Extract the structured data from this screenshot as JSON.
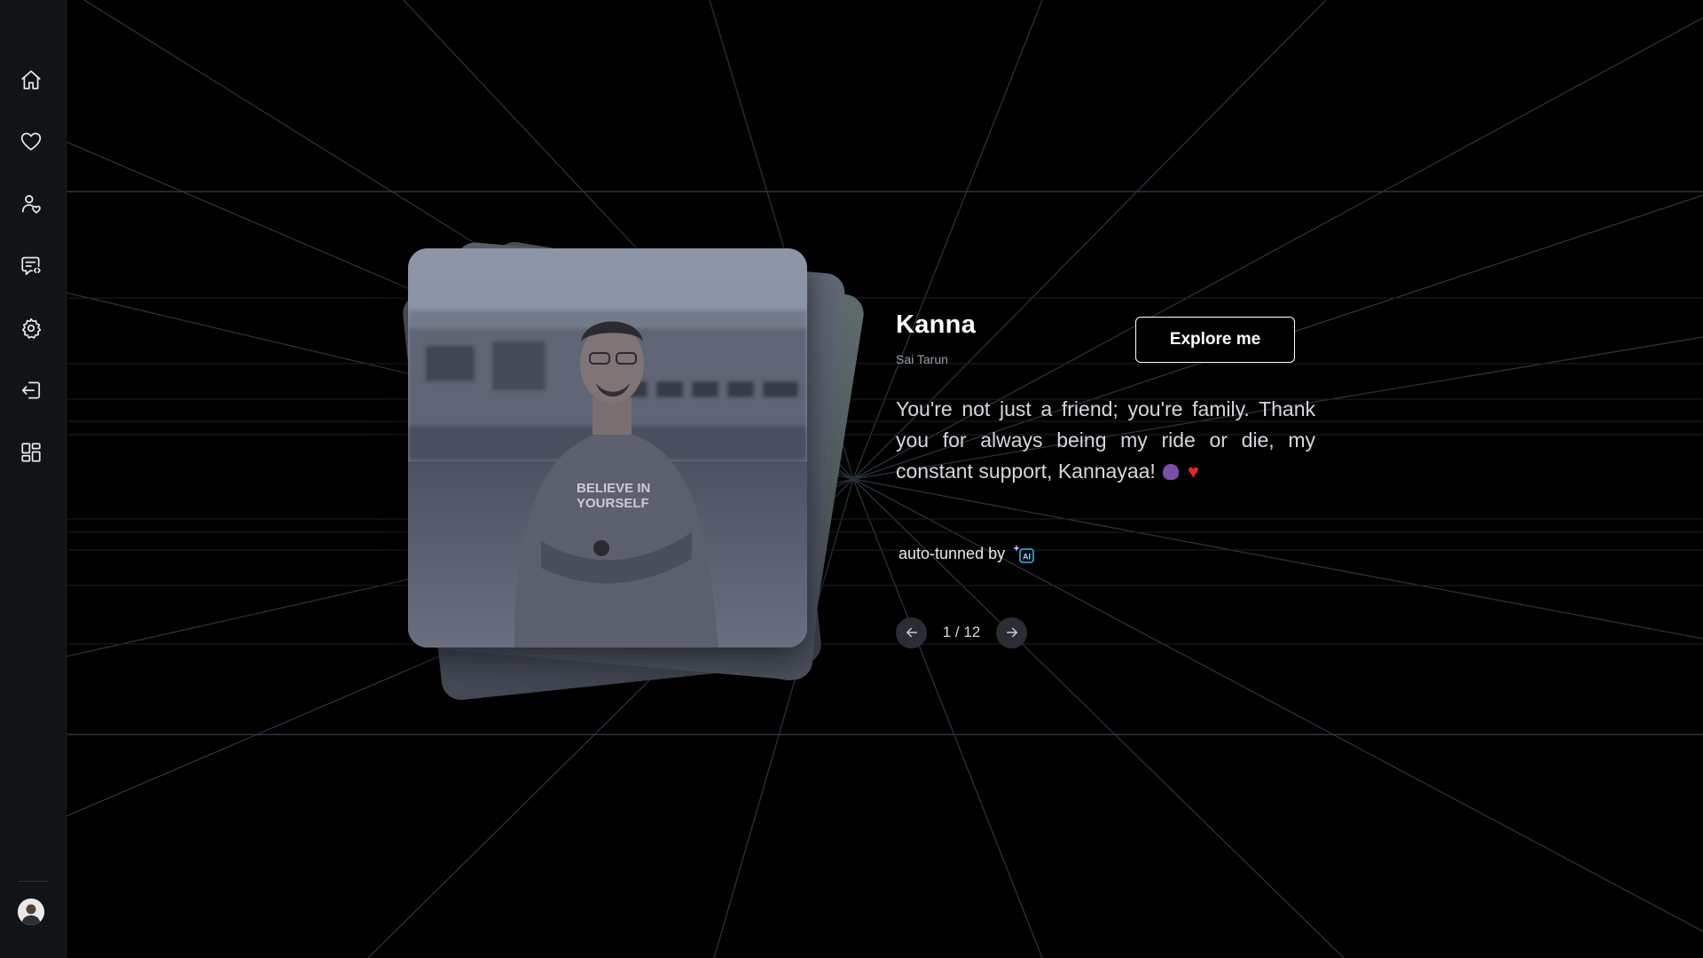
{
  "sidebar": {
    "items": [
      {
        "name": "home",
        "icon": "home-icon"
      },
      {
        "name": "favorites",
        "icon": "heart-icon"
      },
      {
        "name": "friends",
        "icon": "user-heart-icon"
      },
      {
        "name": "messages",
        "icon": "chat-code-icon"
      },
      {
        "name": "settings",
        "icon": "gear-icon"
      },
      {
        "name": "logout",
        "icon": "logout-icon"
      },
      {
        "name": "dashboard",
        "icon": "grid-icon"
      }
    ],
    "avatar_icon": "user-avatar-icon"
  },
  "profile": {
    "name": "Kanna",
    "subname": "Sai Tarun",
    "explore_label": "Explore me",
    "message": "You're not just a friend; you're family. Thank you for always being my ride or die, my constant support, Kannayaa!",
    "autotune_label": "auto-tunned by",
    "ai_badge": "AI"
  },
  "pager": {
    "current": 1,
    "total": 12,
    "label": "1 / 12"
  },
  "colors": {
    "background": "#000000",
    "sidebar": "#111417",
    "grid_line": "#2a323c",
    "heart": "#e0242c",
    "ai_accent": "#2fb3f0"
  }
}
